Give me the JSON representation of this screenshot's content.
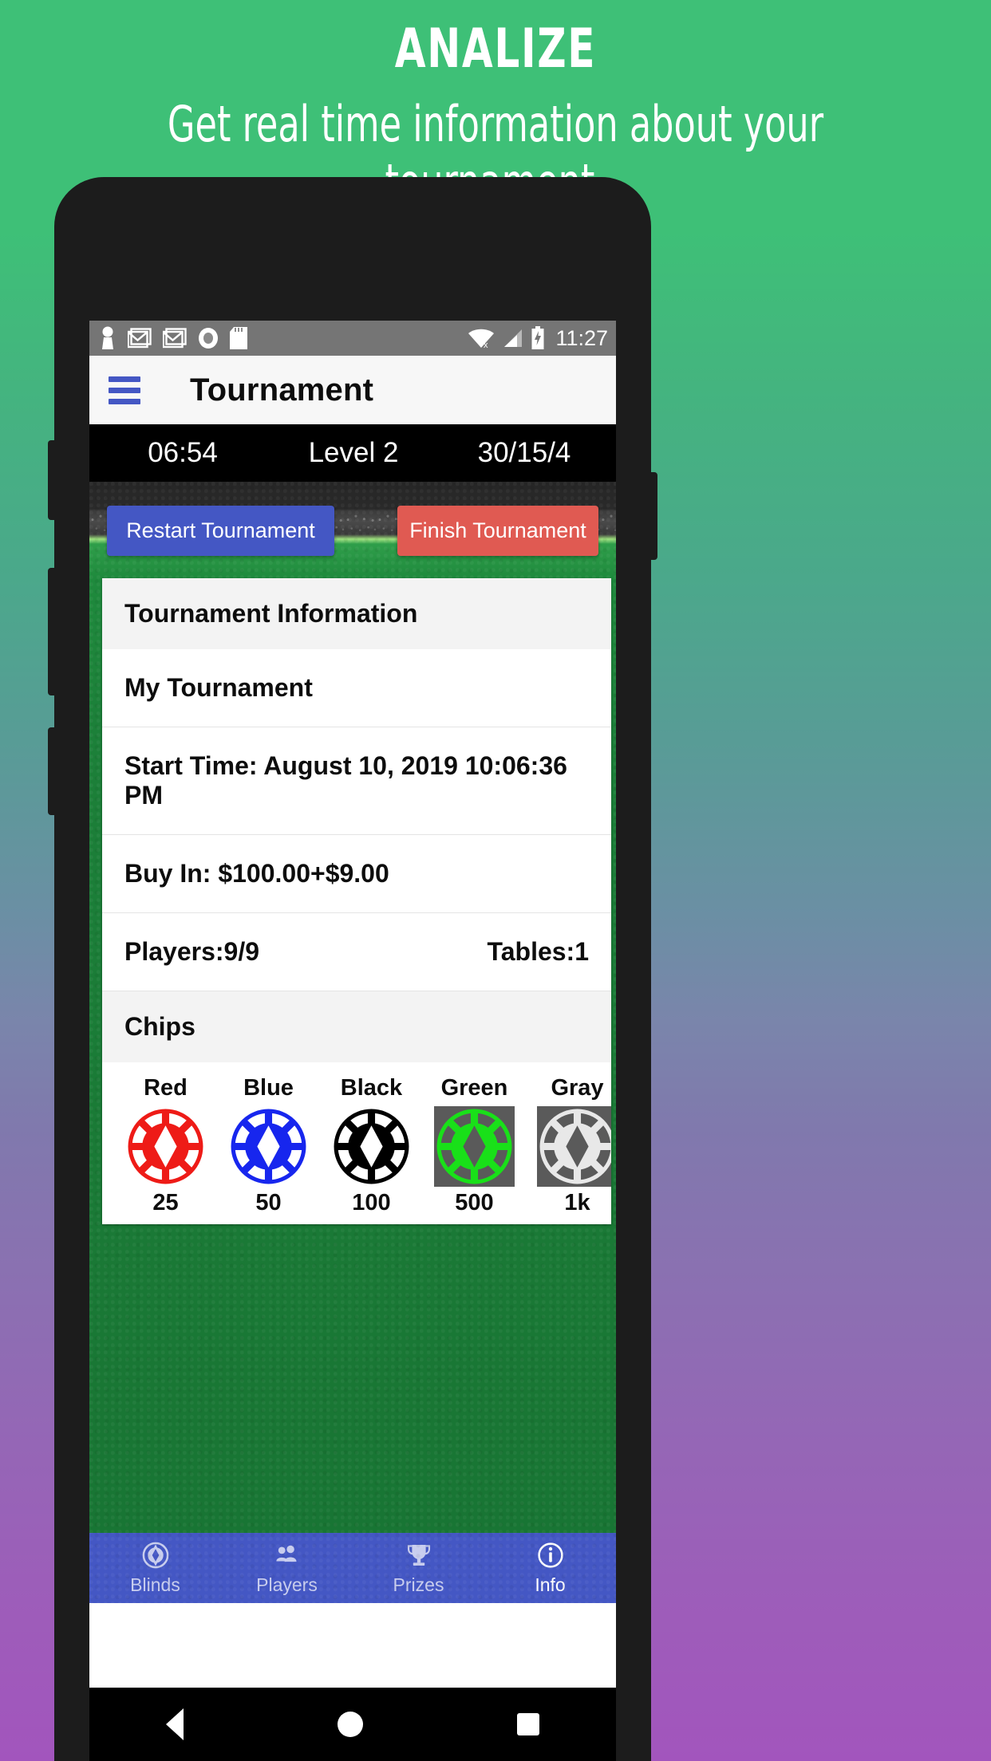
{
  "promo": {
    "title": "ANALIZE",
    "subtitle": "Get real time information about your\ntournament."
  },
  "status_bar": {
    "icons": [
      "person-icon",
      "gmail-icon",
      "gmail-icon",
      "circle-record-icon",
      "sd-card-icon"
    ],
    "right_icons": [
      "wifi-off-icon",
      "cell-signal-icon",
      "battery-charging-icon"
    ],
    "clock": "11:27"
  },
  "app_bar": {
    "menu_icon": "hamburger-menu-icon",
    "title": "Tournament",
    "menu_color": "#4457c4"
  },
  "level_bar": {
    "timer": "06:54",
    "level": "Level 2",
    "blinds": "30/15/4"
  },
  "actions": {
    "restart_label": "Restart Tournament",
    "restart_color": "#4457c4",
    "finish_label": "Finish Tournament",
    "finish_color": "#e05a52"
  },
  "info_card": {
    "header": "Tournament Information",
    "name": "My Tournament",
    "start_time": "Start Time: August 10, 2019 10:06:36 PM",
    "buy_in": "Buy In: $100.00+$9.00",
    "players": "Players:9/9",
    "tables": "Tables:1"
  },
  "chips_section": {
    "header": "Chips",
    "chips": [
      {
        "name": "Red",
        "value": "25",
        "color": "#ee1b17",
        "boxed": false
      },
      {
        "name": "Blue",
        "value": "50",
        "color": "#1726ee",
        "boxed": false
      },
      {
        "name": "Black",
        "value": "100",
        "color": "#000000",
        "boxed": false
      },
      {
        "name": "Green",
        "value": "500",
        "color": "#19e019",
        "boxed": true
      },
      {
        "name": "Gray",
        "value": "1k",
        "color": "#e8e8e8",
        "boxed": true
      }
    ]
  },
  "bottom_nav": {
    "background": "#4457c4",
    "items": [
      {
        "label": "Blinds",
        "icon": "poker-chip-icon",
        "active": false
      },
      {
        "label": "Players",
        "icon": "people-icon",
        "active": false
      },
      {
        "label": "Prizes",
        "icon": "trophy-icon",
        "active": false
      },
      {
        "label": "Info",
        "icon": "info-circle-icon",
        "active": true
      }
    ]
  },
  "android_nav": {
    "back": "back-triangle-icon",
    "home": "home-circle-icon",
    "recents": "recents-square-icon"
  }
}
